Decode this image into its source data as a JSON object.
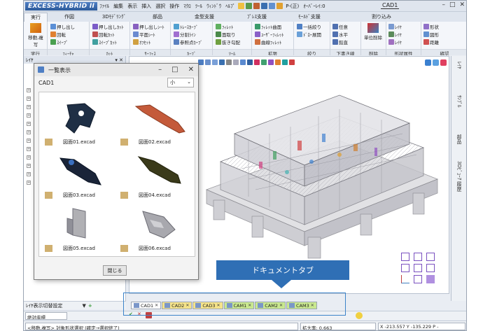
{
  "title_bar": {
    "logo": "EXCESS-HYBRID II",
    "menus": [
      "ﾌｧｲﾙ",
      "編集",
      "表示",
      "挿入",
      "選択",
      "操作",
      "ﾏｸﾛ",
      "ﾂｰﾙ",
      "ｳｨﾝﾄﾞｳ",
      "ﾍﾙﾌﾟ"
    ],
    "layer_label": "P-(正)",
    "snap_label": "ｵｰﾊﾞｰﾚｲ:0",
    "doc_name": "CAD1"
  },
  "ribbon_tabs": [
    "実行",
    "作図",
    "3Dﾓﾃﾞﾘﾝｸﾞ",
    "部品",
    "金型支援",
    "ﾌﾟﾚｽ支援",
    "ﾓｰﾙﾄﾞ支援",
    "",
    "割り込み"
  ],
  "ribbon": {
    "exec_button": "移動,複写",
    "exec_group": "実行",
    "g1": {
      "label": "ﾌｨｰﾁｬ",
      "btns": [
        "押し出し",
        "回転",
        "ｽｲｰﾌﾟ"
      ]
    },
    "g2": {
      "label": "ｶｯﾄ",
      "btns": [
        "押し出しｶｯﾄ",
        "回転ｶｯﾄ",
        "ｽｲｰﾌﾟｶｯﾄ"
      ]
    },
    "g3": {
      "label": "ｻｰﾌｪｽ",
      "btns": [
        "押し出しｼｰﾄ",
        "平面ｼｰﾄ",
        "ｵﾌｾｯﾄ"
      ]
    },
    "g4": {
      "label": "ｶｰﾌﾞ",
      "btns": [
        "ﾄﾚｰｽｶｰﾌﾞ",
        "分割ﾗｲﾝ",
        "参照点ｶｰﾌﾞ"
      ]
    },
    "g5": {
      "label": "ﾂｰﾙ",
      "btns": [
        "ﾌｨﾚｯﾄ",
        "面取り",
        "抜き勾配"
      ]
    },
    "g6": {
      "label": "拡張",
      "btns": [
        "ﾌｨﾚｯﾄ曲面",
        "ﾕｰｻﾞｰﾌｨﾚｯﾄ",
        "曲線ﾌｨﾚｯﾄ"
      ]
    },
    "g7": {
      "label": "絞り",
      "btns": [
        "一括絞り",
        "ﾄﾞﾛｰ展開"
      ]
    },
    "g8": {
      "label": "下書き線",
      "btns": [
        "任意",
        "水平",
        "鉛直"
      ]
    },
    "g9": {
      "label": "削除",
      "btns": [
        "単位削除"
      ]
    },
    "g10": {
      "label": "形状属性",
      "btns": [
        "ﾚｲﾔ",
        "ﾚｲﾔ",
        "ﾚｲﾔ"
      ]
    },
    "g11": {
      "label": "確認",
      "btns": [
        "形状",
        "図形",
        "距離"
      ]
    }
  },
  "left_panel": {
    "header": "ﾚｲﾔ",
    "pin": "▾ ✕"
  },
  "list_window": {
    "title": "一覧表示",
    "folder": "CAD1",
    "size_option": "小",
    "items": [
      "図面01.excad",
      "図面02.excad",
      "図面03.excad",
      "図面04.excad",
      "図面05.excad",
      "図面06.excad"
    ],
    "close_button": "閉じる"
  },
  "right_panel": [
    "ﾚｲﾔ",
    "ｻﾝﾌﾟﾙ",
    "部品",
    "3Dﾋﾞｭｰｱ 履歴"
  ],
  "callout": "ドキュメントタブ",
  "doc_tabs": [
    "CAD1",
    "CAD2",
    "CAD3",
    "CAM1",
    "CAM2",
    "CAM3"
  ],
  "status": {
    "layer_setting": "ﾚｲﾔ表示切替設定",
    "coord_mode": "絶対座標",
    "message": "<移動,複写> 対象形状選択 (確定→選択終了)",
    "zoom": "拡大率: 0.663",
    "coords": "X -213.557 Y -135.229 P -"
  },
  "colors": {
    "accent": "#2f6fb5",
    "tab_yellow": "#f5e38a",
    "tab_green": "#c9e88f",
    "model_gray": "#c8c8cc"
  }
}
